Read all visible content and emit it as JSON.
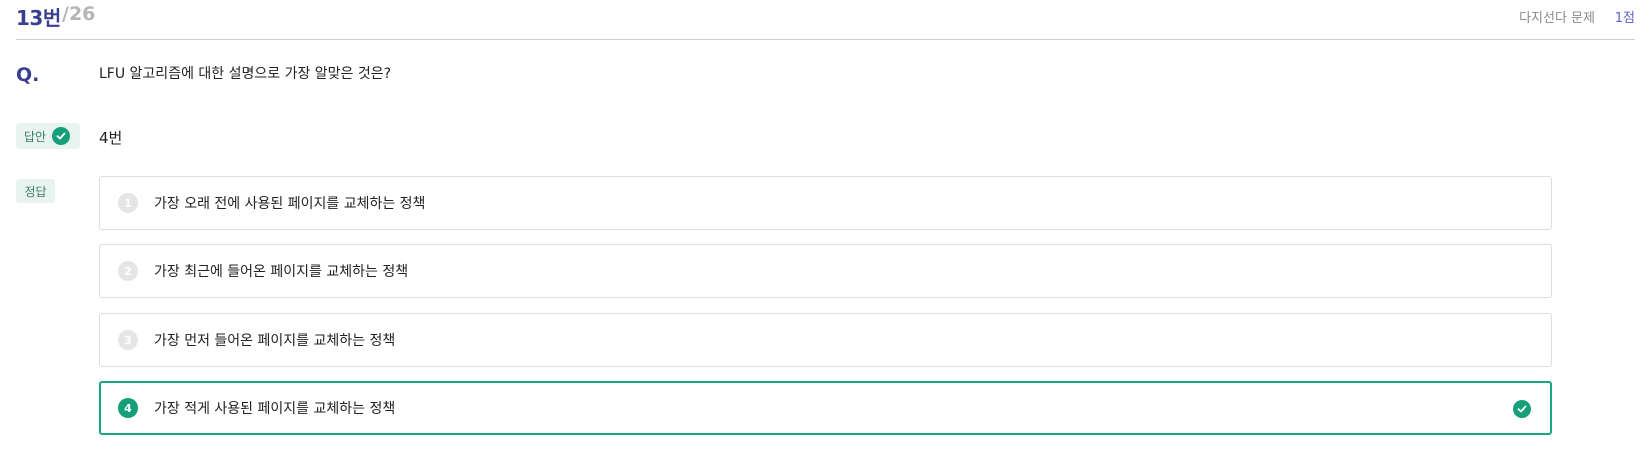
{
  "header": {
    "question_number": "13번",
    "total": "/26",
    "question_type": "다지선다 문제",
    "points": "1점"
  },
  "question": {
    "mark": "Q.",
    "text": "LFU 알고리즘에 대한 설명으로 가장 알맞은 것은?"
  },
  "answer": {
    "tag_label": "답안",
    "value": "4번",
    "status_icon": "check-circle-icon"
  },
  "correct": {
    "tag_label": "정답"
  },
  "options": [
    {
      "number": "1",
      "text": "가장 오래 전에 사용된 페이지를 교체하는 정책"
    },
    {
      "number": "2",
      "text": "가장 최근에 들어온 페이지를 교체하는 정책"
    },
    {
      "number": "3",
      "text": "가장 먼저 들어온 페이지를 교체하는 정책"
    },
    {
      "number": "4",
      "text": "가장 적게 사용된 페이지를 교체하는 정책"
    }
  ],
  "colors": {
    "accent": "#3b3f8f",
    "correct": "#15a07a",
    "tag_bg": "#e9f4f0"
  }
}
